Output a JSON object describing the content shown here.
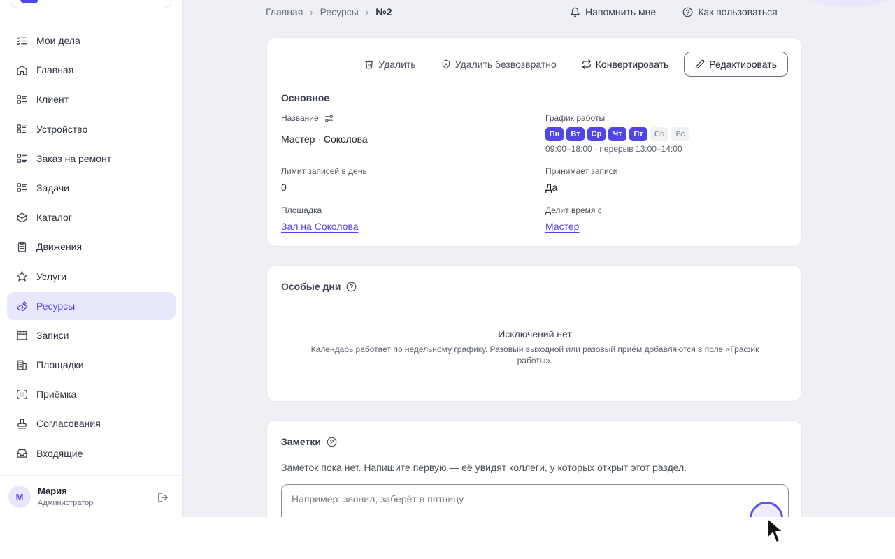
{
  "sidebar": {
    "items": [
      {
        "label": "Мои дела",
        "icon": "checklist-icon"
      },
      {
        "label": "Главная",
        "icon": "home-icon"
      },
      {
        "label": "Клиент",
        "icon": "list-icon"
      },
      {
        "label": "Устройство",
        "icon": "list-icon"
      },
      {
        "label": "Заказ на ремонт",
        "icon": "list-icon"
      },
      {
        "label": "Задачи",
        "icon": "list-icon"
      },
      {
        "label": "Каталог",
        "icon": "box-icon"
      },
      {
        "label": "Движения",
        "icon": "clipboard-icon"
      },
      {
        "label": "Услуги",
        "icon": "star-icon"
      },
      {
        "label": "Ресурсы",
        "icon": "wrench-icon",
        "active": true
      },
      {
        "label": "Записи",
        "icon": "calendar-icon"
      },
      {
        "label": "Площадки",
        "icon": "building-icon"
      },
      {
        "label": "Приёмка",
        "icon": "scan-icon"
      },
      {
        "label": "Согласования",
        "icon": "stamp-icon"
      },
      {
        "label": "Входящие",
        "icon": "inbox-icon"
      }
    ],
    "user": {
      "initial": "М",
      "name": "Мария",
      "role": "Администратор"
    }
  },
  "breadcrumb": {
    "home": "Главная",
    "section": "Ресурсы",
    "current": "№2"
  },
  "top_actions": {
    "remind": "Напомнить мне",
    "help": "Как пользоваться"
  },
  "record_actions": {
    "delete": "Удалить",
    "delete_forever": "Удалить безвозвратно",
    "convert": "Конвертировать",
    "edit": "Редактировать"
  },
  "main": {
    "title": "Основное",
    "name_label": "Название",
    "name_value": "Мастер · Соколова",
    "schedule_label": "График работы",
    "days": [
      {
        "label": "Пн",
        "on": true
      },
      {
        "label": "Вт",
        "on": true
      },
      {
        "label": "Ср",
        "on": true
      },
      {
        "label": "Чт",
        "on": true
      },
      {
        "label": "Пт",
        "on": true
      },
      {
        "label": "Сб",
        "on": false
      },
      {
        "label": "Вс",
        "on": false
      }
    ],
    "hours": "09:00–18:00 · перерыв 13:00–14:00",
    "limit_label": "Лимит записей в день",
    "limit_value": "0",
    "accepts_label": "Принимает записи",
    "accepts_value": "Да",
    "venue_label": "Площадка",
    "venue_value": "Зал на Соколова",
    "shares_label": "Делит время с",
    "shares_value": "Мастер"
  },
  "special_days": {
    "title": "Особые дни",
    "empty_title": "Исключений нет",
    "empty_desc": "Календарь работает по недельному графику. Разовый выходной или разовый приём добавляются в поле «График работы»."
  },
  "notes": {
    "title": "Заметки",
    "empty": "Заметок пока нет. Напишите первую — её увидят коллеги, у которых открыт этот раздел.",
    "placeholder": "Например: звонил, заберёт в пятницу"
  },
  "colors": {
    "accent": "#4f46e5",
    "active_bg": "#e8e8fd",
    "page_bg": "#eef0f5"
  }
}
